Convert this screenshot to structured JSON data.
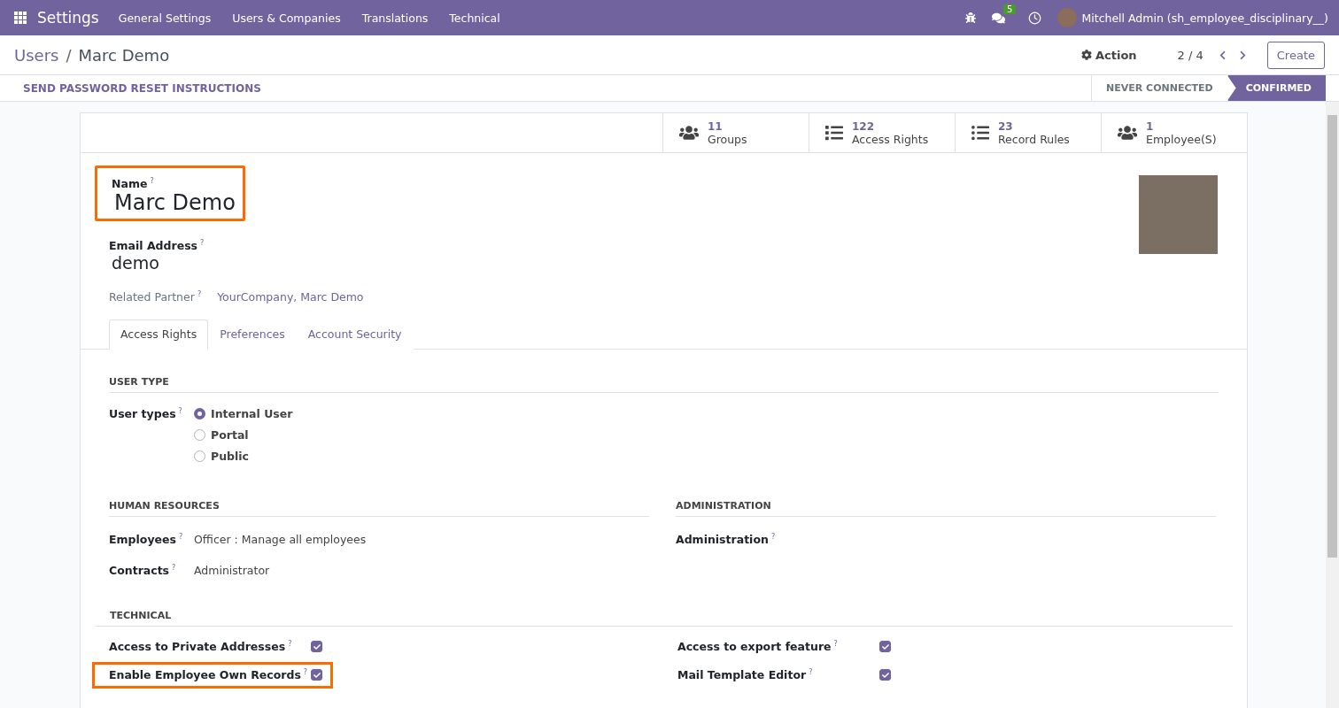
{
  "navbar": {
    "app": "Settings",
    "menus": [
      "General Settings",
      "Users & Companies",
      "Translations",
      "Technical"
    ],
    "message_count": "5",
    "user": "Mitchell Admin (sh_employee_disciplinary__)"
  },
  "breadcrumb": {
    "parent": "Users",
    "separator": "/",
    "current": "Marc Demo"
  },
  "control": {
    "action": "Action",
    "pager": "2 / 4",
    "create": "Create"
  },
  "header_button": "SEND PASSWORD RESET INSTRUCTIONS",
  "statuses": [
    {
      "label": "NEVER CONNECTED",
      "selected": false
    },
    {
      "label": "CONFIRMED",
      "selected": true
    }
  ],
  "stat_buttons": [
    {
      "kind": "users",
      "count": "11",
      "label": "Groups"
    },
    {
      "kind": "list",
      "count": "122",
      "label": "Access Rights"
    },
    {
      "kind": "bullets",
      "count": "23",
      "label": "Record Rules"
    },
    {
      "kind": "users",
      "count": "1",
      "label": "Employee(S)"
    }
  ],
  "name": {
    "label": "Name",
    "help": "?",
    "value": "Marc Demo",
    "highlighted": true
  },
  "email": {
    "label": "Email Address",
    "help": "?",
    "value": "demo"
  },
  "partner": {
    "label": "Related Partner",
    "help": "?",
    "value": "YourCompany, Marc Demo"
  },
  "tabs": [
    {
      "label": "Access Rights",
      "selected": true
    },
    {
      "label": "Preferences",
      "selected": false
    },
    {
      "label": "Account Security",
      "selected": false
    }
  ],
  "user_type": {
    "heading": "USER TYPE",
    "label": "User types",
    "help": "?",
    "options": [
      {
        "label": "Internal User",
        "selected": true
      },
      {
        "label": "Portal",
        "selected": false
      },
      {
        "label": "Public",
        "selected": false
      }
    ]
  },
  "hr": {
    "heading": "HUMAN RESOURCES",
    "fields": [
      {
        "label": "Employees",
        "help": "?",
        "value": "Officer : Manage all employees"
      },
      {
        "label": "Contracts",
        "help": "?",
        "value": "Administrator"
      }
    ]
  },
  "admin": {
    "heading": "ADMINISTRATION",
    "fields": [
      {
        "label": "Administration",
        "help": "?"
      }
    ]
  },
  "technical": {
    "heading": "TECHNICAL",
    "left": [
      {
        "label": "Access to Private Addresses",
        "help": "?",
        "checked": true,
        "highlighted": false
      },
      {
        "label": "Enable Employee Own Records",
        "help": "?",
        "checked": true,
        "highlighted": true
      }
    ],
    "right": [
      {
        "label": "Access to export feature",
        "help": "?",
        "checked": true,
        "highlighted": false
      },
      {
        "label": "Mail Template Editor",
        "help": "?",
        "checked": true,
        "highlighted": false
      }
    ]
  }
}
